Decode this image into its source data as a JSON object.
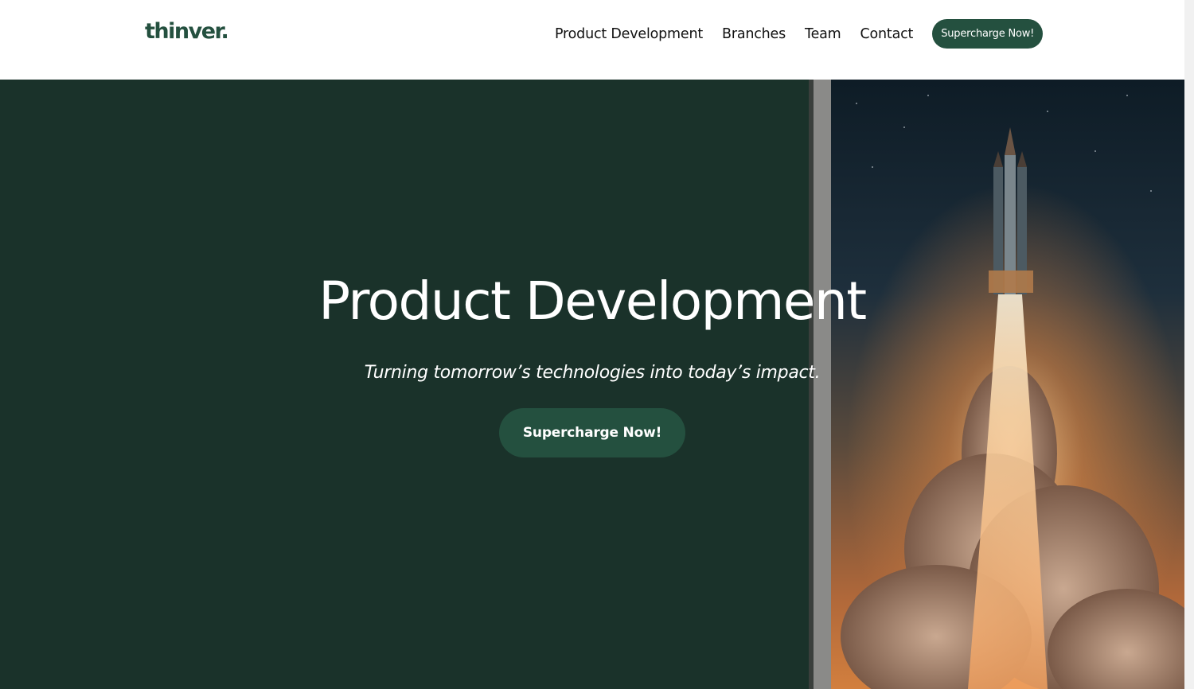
{
  "header": {
    "logo": "thinver.",
    "nav": [
      {
        "label": "Product Development"
      },
      {
        "label": "Branches"
      },
      {
        "label": "Team"
      },
      {
        "label": "Contact"
      }
    ],
    "cta_label": "Supercharge Now!"
  },
  "hero": {
    "title": "Product Development",
    "subtitle": "Turning tomorrow’s technologies into today’s impact.",
    "cta_label": "Supercharge Now!",
    "image": "rocket-launch-photo"
  },
  "colors": {
    "brand_green": "#24503f",
    "hero_background": "#1a322a",
    "header_background": "#ffffff"
  }
}
